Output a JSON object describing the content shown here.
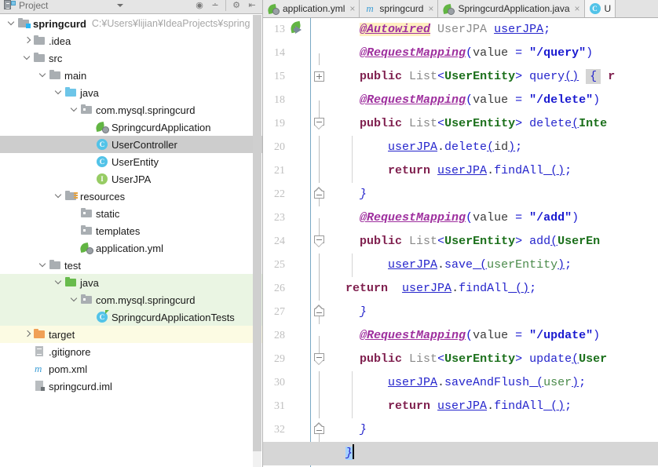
{
  "project_panel": {
    "header": {
      "title": "Project",
      "icons": [
        "project-view-icon",
        "dropdown-caret-icon",
        "locate-icon",
        "expand-collapse-icon",
        "settings-gear-icon",
        "hide-panel-icon"
      ]
    },
    "tree": [
      {
        "indent": 0,
        "toggle": "down",
        "icon": "module-folder-icon",
        "label": "springcurd",
        "bold": true,
        "path": "C:¥Users¥lijian¥IdeaProjects¥spring",
        "state": "normal"
      },
      {
        "indent": 1,
        "toggle": "right",
        "icon": "folder-icon",
        "label": ".idea",
        "bold": false,
        "path": "",
        "state": "normal"
      },
      {
        "indent": 1,
        "toggle": "down",
        "icon": "folder-icon",
        "label": "src",
        "bold": false,
        "path": "",
        "state": "normal"
      },
      {
        "indent": 2,
        "toggle": "down",
        "icon": "folder-icon",
        "label": "main",
        "bold": false,
        "path": "",
        "state": "normal"
      },
      {
        "indent": 3,
        "toggle": "down",
        "icon": "folder-blue-icon",
        "label": "java",
        "bold": false,
        "path": "",
        "state": "normal"
      },
      {
        "indent": 4,
        "toggle": "down",
        "icon": "package-icon",
        "label": "com.mysql.springcurd",
        "bold": false,
        "path": "",
        "state": "normal"
      },
      {
        "indent": 5,
        "toggle": "none",
        "icon": "spring-class-icon",
        "label": "SpringcurdApplication",
        "bold": false,
        "path": "",
        "state": "normal"
      },
      {
        "indent": 5,
        "toggle": "none",
        "icon": "class-icon",
        "label": "UserController",
        "bold": false,
        "path": "",
        "state": "selected"
      },
      {
        "indent": 5,
        "toggle": "none",
        "icon": "class-icon",
        "label": "UserEntity",
        "bold": false,
        "path": "",
        "state": "normal"
      },
      {
        "indent": 5,
        "toggle": "none",
        "icon": "interface-icon",
        "label": "UserJPA",
        "bold": false,
        "path": "",
        "state": "normal"
      },
      {
        "indent": 3,
        "toggle": "down",
        "icon": "resources-folder-icon",
        "label": "resources",
        "bold": false,
        "path": "",
        "state": "normal"
      },
      {
        "indent": 4,
        "toggle": "none",
        "icon": "package-icon",
        "label": "static",
        "bold": false,
        "path": "",
        "state": "normal"
      },
      {
        "indent": 4,
        "toggle": "none",
        "icon": "package-icon",
        "label": "templates",
        "bold": false,
        "path": "",
        "state": "normal"
      },
      {
        "indent": 4,
        "toggle": "none",
        "icon": "spring-yaml-icon",
        "label": "application.yml",
        "bold": false,
        "path": "",
        "state": "normal"
      },
      {
        "indent": 2,
        "toggle": "down",
        "icon": "folder-icon",
        "label": "test",
        "bold": false,
        "path": "",
        "state": "normal"
      },
      {
        "indent": 3,
        "toggle": "down",
        "icon": "folder-green-icon",
        "label": "java",
        "bold": false,
        "path": "",
        "state": "green"
      },
      {
        "indent": 4,
        "toggle": "down",
        "icon": "package-icon",
        "label": "com.mysql.springcurd",
        "bold": false,
        "path": "",
        "state": "green"
      },
      {
        "indent": 5,
        "toggle": "none",
        "icon": "test-class-icon",
        "label": "SpringcurdApplicationTests",
        "bold": false,
        "path": "",
        "state": "green"
      },
      {
        "indent": 1,
        "toggle": "right",
        "icon": "folder-orange-icon",
        "label": "target",
        "bold": false,
        "path": "",
        "state": "yellow"
      },
      {
        "indent": 1,
        "toggle": "none",
        "icon": "file-icon",
        "label": ".gitignore",
        "bold": false,
        "path": "",
        "state": "normal"
      },
      {
        "indent": 1,
        "toggle": "none",
        "icon": "maven-icon",
        "label": "pom.xml",
        "bold": false,
        "path": "",
        "state": "normal"
      },
      {
        "indent": 1,
        "toggle": "none",
        "icon": "iml-icon",
        "label": "springcurd.iml",
        "bold": false,
        "path": "",
        "state": "normal"
      }
    ]
  },
  "editor": {
    "tabs": [
      {
        "label": "application.yml",
        "icon": "spring-yaml-icon",
        "active": false,
        "closable": true
      },
      {
        "label": "springcurd",
        "icon": "maven-icon",
        "active": false,
        "closable": true
      },
      {
        "label": "SpringcurdApplication.java",
        "icon": "spring-class-icon",
        "active": false,
        "closable": true
      },
      {
        "label": "U",
        "icon": "class-icon",
        "active": true,
        "closable": false
      }
    ],
    "lines": [
      {
        "num": "13",
        "gutter": "run",
        "fold": "none",
        "indent_guide": false,
        "tokens": [
          {
            "t": "    ",
            "c": "tk-plain"
          },
          {
            "t": "@Autowired",
            "c": "tk-ann tk-annhl"
          },
          {
            "t": " ",
            "c": "tk-plain"
          },
          {
            "t": "UserJPA",
            "c": "tk-type"
          },
          {
            "t": " ",
            "c": "tk-plain"
          },
          {
            "t": "userJPA",
            "c": "tk-field"
          },
          {
            "t": ";",
            "c": "tk-punct"
          }
        ]
      },
      {
        "num": "14",
        "gutter": "none",
        "fold": "line-bot",
        "indent_guide": false,
        "tokens": [
          {
            "t": "    ",
            "c": "tk-plain"
          },
          {
            "t": "@RequestMapping",
            "c": "tk-ann"
          },
          {
            "t": "(",
            "c": "tk-punct"
          },
          {
            "t": "value",
            "c": "tk-plain"
          },
          {
            "t": " = ",
            "c": "tk-punct"
          },
          {
            "t": "\"/query\"",
            "c": "tk-str"
          },
          {
            "t": ")",
            "c": "tk-punct"
          }
        ]
      },
      {
        "num": "15",
        "gutter": "none",
        "fold": "collapsed",
        "indent_guide": false,
        "tokens": [
          {
            "t": "    ",
            "c": "tk-plain"
          },
          {
            "t": "public",
            "c": "tk-kw"
          },
          {
            "t": " ",
            "c": "tk-plain"
          },
          {
            "t": "List",
            "c": "tk-type"
          },
          {
            "t": "<",
            "c": "tk-punct"
          },
          {
            "t": "UserEntity",
            "c": "tk-gen"
          },
          {
            "t": ">",
            "c": "tk-punct"
          },
          {
            "t": " ",
            "c": "tk-plain"
          },
          {
            "t": "query",
            "c": "tk-meth"
          },
          {
            "t": "()",
            "c": "tk-field"
          },
          {
            "t": " ",
            "c": "tk-plain"
          },
          {
            "t": "{",
            "c": "fold-ph"
          },
          {
            "t": " r",
            "c": "tk-kw"
          }
        ]
      },
      {
        "num": "18",
        "gutter": "none",
        "fold": "line-bot",
        "indent_guide": false,
        "tokens": [
          {
            "t": "    ",
            "c": "tk-plain"
          },
          {
            "t": "@RequestMapping",
            "c": "tk-ann"
          },
          {
            "t": "(",
            "c": "tk-punct"
          },
          {
            "t": "value",
            "c": "tk-plain"
          },
          {
            "t": " = ",
            "c": "tk-punct"
          },
          {
            "t": "\"/delete\"",
            "c": "tk-str"
          },
          {
            "t": ")",
            "c": "tk-punct"
          }
        ]
      },
      {
        "num": "19",
        "gutter": "none",
        "fold": "start",
        "indent_guide": false,
        "tokens": [
          {
            "t": "    ",
            "c": "tk-plain"
          },
          {
            "t": "public",
            "c": "tk-kw"
          },
          {
            "t": " ",
            "c": "tk-plain"
          },
          {
            "t": "List",
            "c": "tk-type"
          },
          {
            "t": "<",
            "c": "tk-punct"
          },
          {
            "t": "UserEntity",
            "c": "tk-gen"
          },
          {
            "t": ">",
            "c": "tk-punct"
          },
          {
            "t": " ",
            "c": "tk-plain"
          },
          {
            "t": "delete",
            "c": "tk-meth"
          },
          {
            "t": "(",
            "c": "tk-field"
          },
          {
            "t": "Inte",
            "c": "tk-gen"
          }
        ]
      },
      {
        "num": "20",
        "gutter": "none",
        "fold": "line",
        "indent_guide": true,
        "tokens": [
          {
            "t": "        ",
            "c": "tk-plain"
          },
          {
            "t": "userJPA",
            "c": "tk-field"
          },
          {
            "t": ".",
            "c": "tk-plain"
          },
          {
            "t": "delete",
            "c": "tk-meth"
          },
          {
            "t": "(",
            "c": "tk-field"
          },
          {
            "t": "id",
            "c": "tk-plain"
          },
          {
            "t": ")",
            "c": "tk-field"
          },
          {
            "t": ";",
            "c": "tk-punct"
          }
        ]
      },
      {
        "num": "21",
        "gutter": "none",
        "fold": "line",
        "indent_guide": true,
        "tokens": [
          {
            "t": "        ",
            "c": "tk-plain"
          },
          {
            "t": "return",
            "c": "tk-kw"
          },
          {
            "t": " ",
            "c": "tk-plain"
          },
          {
            "t": "userJPA",
            "c": "tk-field"
          },
          {
            "t": ".",
            "c": "tk-plain"
          },
          {
            "t": "findAll",
            "c": "tk-meth"
          },
          {
            "t": " ()",
            "c": "tk-field"
          },
          {
            "t": ";",
            "c": "tk-punct"
          }
        ]
      },
      {
        "num": "22",
        "gutter": "none",
        "fold": "end",
        "indent_guide": false,
        "tokens": [
          {
            "t": "    ",
            "c": "tk-plain"
          },
          {
            "t": "}",
            "c": "tk-brace"
          }
        ]
      },
      {
        "num": "23",
        "gutter": "none",
        "fold": "line-bot",
        "indent_guide": false,
        "tokens": [
          {
            "t": "    ",
            "c": "tk-plain"
          },
          {
            "t": "@RequestMapping",
            "c": "tk-ann"
          },
          {
            "t": "(",
            "c": "tk-punct"
          },
          {
            "t": "value",
            "c": "tk-plain"
          },
          {
            "t": " = ",
            "c": "tk-punct"
          },
          {
            "t": "\"/add\"",
            "c": "tk-str"
          },
          {
            "t": ")",
            "c": "tk-punct"
          }
        ]
      },
      {
        "num": "24",
        "gutter": "none",
        "fold": "start",
        "indent_guide": false,
        "tokens": [
          {
            "t": "    ",
            "c": "tk-plain"
          },
          {
            "t": "public",
            "c": "tk-kw"
          },
          {
            "t": " ",
            "c": "tk-plain"
          },
          {
            "t": "List",
            "c": "tk-type"
          },
          {
            "t": "<",
            "c": "tk-punct"
          },
          {
            "t": "UserEntity",
            "c": "tk-gen"
          },
          {
            "t": ">",
            "c": "tk-punct"
          },
          {
            "t": " ",
            "c": "tk-plain"
          },
          {
            "t": "add",
            "c": "tk-meth"
          },
          {
            "t": "(",
            "c": "tk-field"
          },
          {
            "t": "UserEn",
            "c": "tk-gen"
          }
        ]
      },
      {
        "num": "25",
        "gutter": "none",
        "fold": "line",
        "indent_guide": true,
        "tokens": [
          {
            "t": "        ",
            "c": "tk-plain"
          },
          {
            "t": "userJPA",
            "c": "tk-field"
          },
          {
            "t": ".",
            "c": "tk-plain"
          },
          {
            "t": "save",
            "c": "tk-meth"
          },
          {
            "t": " (",
            "c": "tk-field"
          },
          {
            "t": "userEntity",
            "c": "tk-param"
          },
          {
            "t": ")",
            "c": "tk-field"
          },
          {
            "t": ";",
            "c": "tk-punct"
          }
        ]
      },
      {
        "num": "26",
        "gutter": "none",
        "fold": "line",
        "indent_guide": false,
        "tokens": [
          {
            "t": "  ",
            "c": "tk-plain"
          },
          {
            "t": "return",
            "c": "tk-kw"
          },
          {
            "t": "  ",
            "c": "tk-plain"
          },
          {
            "t": "userJPA",
            "c": "tk-field"
          },
          {
            "t": ".",
            "c": "tk-plain"
          },
          {
            "t": "findAll",
            "c": "tk-meth"
          },
          {
            "t": " ()",
            "c": "tk-field"
          },
          {
            "t": ";",
            "c": "tk-punct"
          }
        ]
      },
      {
        "num": "27",
        "gutter": "none",
        "fold": "end",
        "indent_guide": false,
        "tokens": [
          {
            "t": "    ",
            "c": "tk-plain"
          },
          {
            "t": "}",
            "c": "tk-brace"
          }
        ]
      },
      {
        "num": "28",
        "gutter": "none",
        "fold": "line-bot",
        "indent_guide": false,
        "tokens": [
          {
            "t": "    ",
            "c": "tk-plain"
          },
          {
            "t": "@RequestMapping",
            "c": "tk-ann"
          },
          {
            "t": "(",
            "c": "tk-punct"
          },
          {
            "t": "value",
            "c": "tk-plain"
          },
          {
            "t": " = ",
            "c": "tk-punct"
          },
          {
            "t": "\"/update\"",
            "c": "tk-str"
          },
          {
            "t": ")",
            "c": "tk-punct"
          }
        ]
      },
      {
        "num": "29",
        "gutter": "none",
        "fold": "start",
        "indent_guide": false,
        "tokens": [
          {
            "t": "    ",
            "c": "tk-plain"
          },
          {
            "t": "public",
            "c": "tk-kw"
          },
          {
            "t": " ",
            "c": "tk-plain"
          },
          {
            "t": "List",
            "c": "tk-type"
          },
          {
            "t": "<",
            "c": "tk-punct"
          },
          {
            "t": "UserEntity",
            "c": "tk-gen"
          },
          {
            "t": ">",
            "c": "tk-punct"
          },
          {
            "t": " ",
            "c": "tk-plain"
          },
          {
            "t": "update",
            "c": "tk-meth"
          },
          {
            "t": "(",
            "c": "tk-field"
          },
          {
            "t": "User",
            "c": "tk-gen"
          }
        ]
      },
      {
        "num": "30",
        "gutter": "none",
        "fold": "line",
        "indent_guide": true,
        "tokens": [
          {
            "t": "        ",
            "c": "tk-plain"
          },
          {
            "t": "userJPA",
            "c": "tk-field"
          },
          {
            "t": ".",
            "c": "tk-plain"
          },
          {
            "t": "saveAndFlush",
            "c": "tk-meth"
          },
          {
            "t": " (",
            "c": "tk-field"
          },
          {
            "t": "user",
            "c": "tk-param"
          },
          {
            "t": ")",
            "c": "tk-field"
          },
          {
            "t": ";",
            "c": "tk-punct"
          }
        ]
      },
      {
        "num": "31",
        "gutter": "none",
        "fold": "line",
        "indent_guide": true,
        "tokens": [
          {
            "t": "        ",
            "c": "tk-plain"
          },
          {
            "t": "return",
            "c": "tk-kw"
          },
          {
            "t": " ",
            "c": "tk-plain"
          },
          {
            "t": "userJPA",
            "c": "tk-field"
          },
          {
            "t": ".",
            "c": "tk-plain"
          },
          {
            "t": "findAll",
            "c": "tk-meth"
          },
          {
            "t": " ()",
            "c": "tk-field"
          },
          {
            "t": ";",
            "c": "tk-punct"
          }
        ]
      },
      {
        "num": "32",
        "gutter": "none",
        "fold": "end",
        "indent_guide": false,
        "tokens": [
          {
            "t": "    ",
            "c": "tk-plain"
          },
          {
            "t": "}",
            "c": "tk-brace"
          }
        ]
      },
      {
        "num": "",
        "gutter": "none",
        "fold": "none",
        "caret_line": true,
        "indent_guide": false,
        "tokens": [
          {
            "t": "  ",
            "c": "tk-plain"
          },
          {
            "t": "}",
            "c": "tk-brace sel-hl"
          },
          {
            "t": "CARET",
            "c": "caret"
          }
        ]
      }
    ]
  },
  "colors": {
    "selection_row": "#cdcdcd",
    "test_scope_green": "#eaf5e3",
    "excluded_yellow": "#fcfbe3",
    "caret_line": "#d6d6d6",
    "annotation_purple": "#9e2f9e",
    "string_blue": "#1a1ad0",
    "keyword_maroon": "#7f1f4e",
    "generic_green": "#1a6f1a",
    "selection_blue": "#a6d2ff"
  }
}
